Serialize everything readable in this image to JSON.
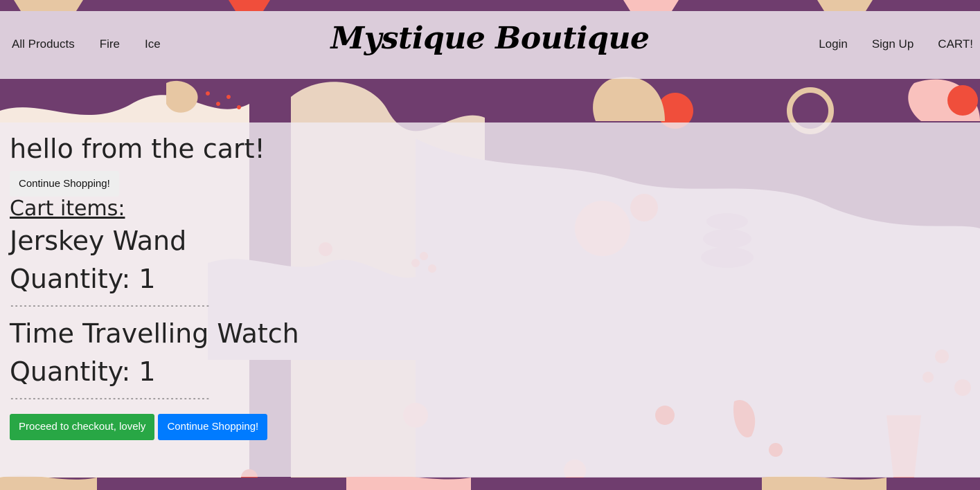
{
  "header": {
    "brand": "Mystique Boutique",
    "nav_left": [
      "All Products",
      "Fire",
      "Ice"
    ],
    "nav_right": [
      "Login",
      "Sign Up",
      "CART!"
    ]
  },
  "cart": {
    "greeting": "hello from the cart!",
    "continue_top": "Continue Shopping!",
    "heading": "Cart items:",
    "items": [
      {
        "name": "Jerskey Wand",
        "quantity_label": "Quantity: 1"
      },
      {
        "name": "Time Travelling Watch",
        "quantity_label": "Quantity: 1"
      }
    ],
    "divider": "---------------------------------------------",
    "checkout_label": "Proceed to checkout, lovely",
    "continue_bottom": "Continue Shopping!"
  },
  "colors": {
    "page_band": "#6f3d6e",
    "checkout": "#28a745",
    "continue": "#007bff"
  }
}
